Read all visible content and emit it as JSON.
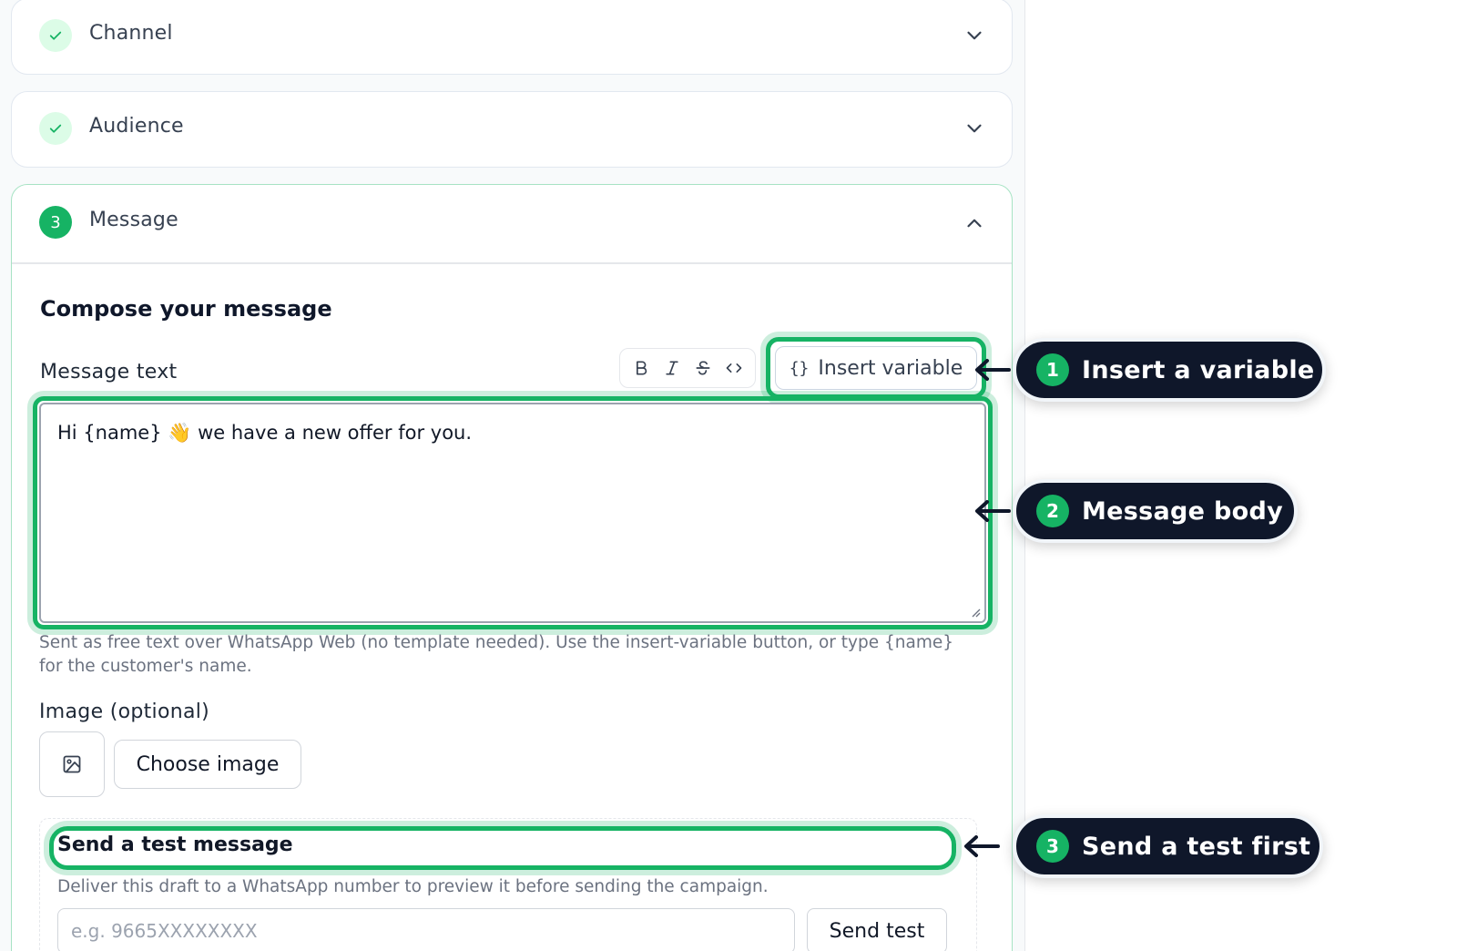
{
  "steps": [
    {
      "title": "Channel",
      "state": "done"
    },
    {
      "title": "Audience",
      "state": "done"
    },
    {
      "title": "Message",
      "number": "3",
      "state": "active"
    }
  ],
  "message": {
    "section_title": "Compose your message",
    "text_label": "Message text",
    "toolbar": [
      "bold-icon",
      "italic-icon",
      "strikethrough-icon",
      "code-icon"
    ],
    "insert_variable_icon": "{}",
    "insert_variable_label": "Insert variable",
    "body_text": "Hi {name} 👋 we have a new offer for you.",
    "help_text": "Sent as free text over WhatsApp Web (no template needed). Use the insert-variable button, or type {name} for the customer's name.",
    "image_label": "Image (optional)",
    "choose_image_label": "Choose image"
  },
  "test": {
    "title": "Send a test message",
    "description": "Deliver this draft to a WhatsApp number to preview it before sending the campaign.",
    "phone_placeholder": "e.g. 9665XXXXXXXX",
    "send_label": "Send test"
  },
  "callouts": [
    {
      "number": "1",
      "text": "Insert a variable"
    },
    {
      "number": "2",
      "text": "Message body"
    },
    {
      "number": "3",
      "text": "Send a test first"
    }
  ],
  "colors": {
    "accent": "#16b364",
    "callout_bg": "#0f172a"
  }
}
